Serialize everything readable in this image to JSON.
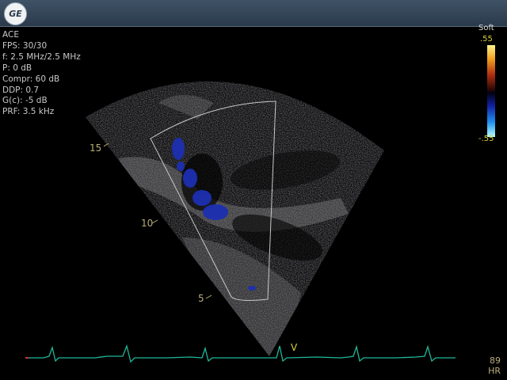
{
  "app": {
    "logo_text": "GE"
  },
  "parameters": [
    "ACE",
    "FPS: 30/30",
    "f: 2.5 MHz/2.5 MHz",
    "P: 0 dB",
    "Compr: 60 dB",
    "DDP: 0.7",
    "G(c): -5 dB",
    "PRF: 3.5 kHz"
  ],
  "color_scale": {
    "title": "Soft",
    "max_label": ".55",
    "min_label": "-.55",
    "colors": {
      "positive": "#f0a020",
      "negative": "#2090f0"
    }
  },
  "depth_markers": [
    "15",
    "10",
    "5"
  ],
  "ecg": {
    "marker_label": "V",
    "trace_color": "#1fb89a",
    "marker_color": "#d8d03c"
  },
  "heart_rate": {
    "value": "89",
    "unit": "HR"
  }
}
